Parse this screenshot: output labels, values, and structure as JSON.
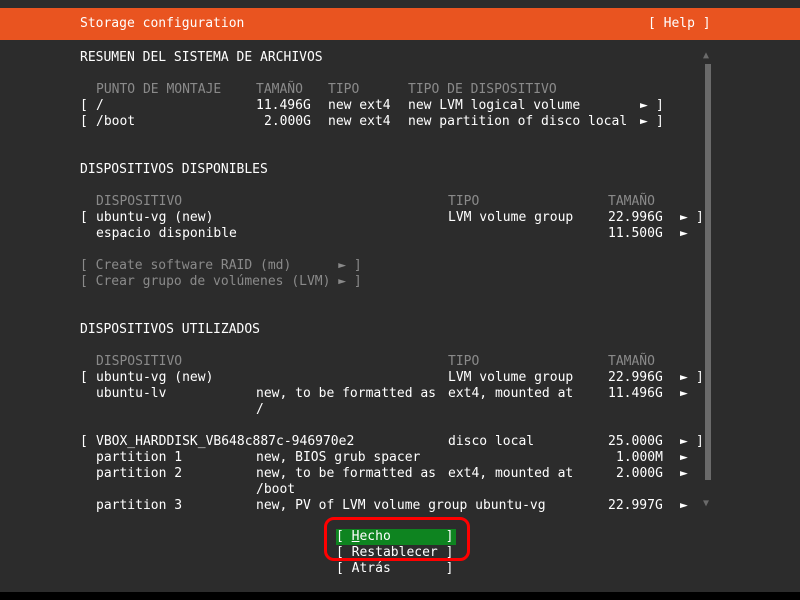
{
  "header": {
    "title": "Storage configuration",
    "help": "[ Help ]"
  },
  "fs_summary": {
    "heading": "RESUMEN DEL SISTEMA DE ARCHIVOS",
    "columns": [
      "PUNTO DE MONTAJE",
      "TAMAÑO",
      "TIPO",
      "TIPO DE DISPOSITIVO"
    ],
    "rows": [
      {
        "open": "[",
        "mount": "/",
        "size": "11.496G",
        "type": "new ext4",
        "device_type": "new LVM logical volume",
        "arrow": "►",
        "close": "]"
      },
      {
        "open": "[",
        "mount": "/boot",
        "size": "2.000G",
        "type": "new ext4",
        "device_type": "new partition of disco local",
        "arrow": "►",
        "close": "]"
      }
    ]
  },
  "available": {
    "heading": "DISPOSITIVOS DISPONIBLES",
    "columns": [
      "DISPOSITIVO",
      "TIPO",
      "TAMAÑO"
    ],
    "rows": [
      {
        "open": "[",
        "device": "ubuntu-vg (new)",
        "type": "LVM volume group",
        "size": "22.996G",
        "arrow": "►",
        "close": "]"
      },
      {
        "device": "espacio disponible",
        "size": "11.500G",
        "arrow": "►"
      }
    ],
    "actions": [
      {
        "label": "[ Create software RAID (md)      ► ]"
      },
      {
        "label": "[ Crear grupo de volúmenes (LVM) ► ]"
      }
    ]
  },
  "used": {
    "heading": "DISPOSITIVOS UTILIZADOS",
    "columns": [
      "DISPOSITIVO",
      "TIPO",
      "TAMAÑO"
    ],
    "vg_row": {
      "open": "[",
      "device": "ubuntu-vg (new)",
      "type": "LVM volume group",
      "size": "22.996G",
      "arrow": "►",
      "close": "]"
    },
    "lv_row": {
      "device": "ubuntu-lv",
      "desc": "new, to be formatted as",
      "type": "ext4, mounted at",
      "desc2": "/",
      "size": "11.496G",
      "arrow": "►"
    },
    "disk_row": {
      "open": "[",
      "device": "VBOX_HARDDISK_VB648c887c-946970e2",
      "type": "disco local",
      "size": "25.000G",
      "arrow": "►",
      "close": "]"
    },
    "partitions": [
      {
        "device": "partition 1",
        "desc": "new, BIOS grub spacer",
        "type": "",
        "desc2": "",
        "size": "1.000M",
        "arrow": "►"
      },
      {
        "device": "partition 2",
        "desc": "new, to be formatted as",
        "type": "ext4, mounted at",
        "desc2": "/boot",
        "size": "2.000G",
        "arrow": "►"
      },
      {
        "device": "partition 3",
        "desc": "new, PV of LVM volume group ubuntu-vg",
        "type": "",
        "desc2": "",
        "size": "22.997G",
        "arrow": "►"
      }
    ]
  },
  "buttons": {
    "done": {
      "open": "[ ",
      "accel": "H",
      "rest": "echo",
      "close": "       ]"
    },
    "reset": {
      "label": "[ Restablecer ]"
    },
    "back": {
      "label": "[ Atrás       ]"
    }
  },
  "scrollbar": {
    "up": "▲",
    "down": "▼"
  },
  "colors": {
    "accent": "#e95420",
    "focus": "#0e8420",
    "background": "#2c2c2c",
    "annotation": "#ff0000"
  }
}
